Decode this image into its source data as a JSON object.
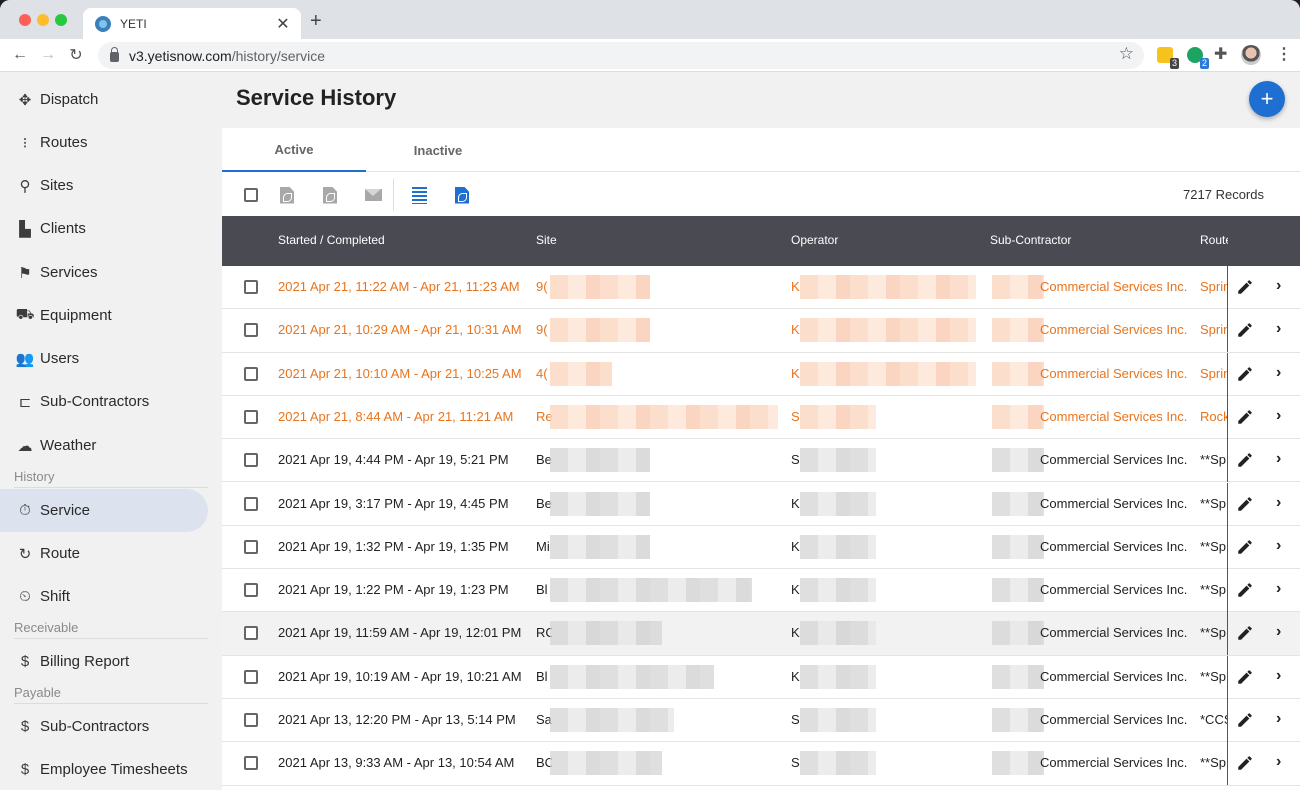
{
  "browser": {
    "tab_title": "YETI",
    "url_host": "v3.yetisnow.com",
    "url_path": "/history/service",
    "extensions": [
      {
        "name": "yellow-extension",
        "badge": "3"
      },
      {
        "name": "green-extension",
        "badge": "2"
      }
    ]
  },
  "sidebar": {
    "items": [
      {
        "label": "Dispatch",
        "icon": "dispatch-icon",
        "glyph": "✥"
      },
      {
        "label": "Routes",
        "icon": "routes-icon",
        "glyph": "⁝"
      },
      {
        "label": "Sites",
        "icon": "sites-icon",
        "glyph": "⚲"
      },
      {
        "label": "Clients",
        "icon": "clients-icon",
        "glyph": "▙"
      },
      {
        "label": "Services",
        "icon": "services-icon",
        "glyph": "⚑"
      },
      {
        "label": "Equipment",
        "icon": "equipment-icon",
        "glyph": "⛟"
      },
      {
        "label": "Users",
        "icon": "users-icon",
        "glyph": "👥"
      },
      {
        "label": "Sub-Contractors",
        "icon": "subcontractors-icon",
        "glyph": "⊏"
      },
      {
        "label": "Weather",
        "icon": "cloud-icon",
        "glyph": "☁"
      }
    ],
    "sections": [
      {
        "title": "History",
        "items": [
          {
            "label": "Service",
            "icon": "service-history-icon",
            "glyph": "⏱",
            "active": true
          },
          {
            "label": "Route",
            "icon": "route-history-icon",
            "glyph": "↻"
          },
          {
            "label": "Shift",
            "icon": "shift-history-icon",
            "glyph": "⏲"
          }
        ]
      },
      {
        "title": "Receivable",
        "items": [
          {
            "label": "Billing Report",
            "icon": "billing-icon",
            "glyph": "$"
          }
        ]
      },
      {
        "title": "Payable",
        "items": [
          {
            "label": "Sub-Contractors",
            "icon": "payable-subcontractors-icon",
            "glyph": "$"
          },
          {
            "label": "Employee Timesheets",
            "icon": "timesheets-icon",
            "glyph": "$"
          }
        ]
      }
    ]
  },
  "main": {
    "title": "Service History",
    "fab_label": "+",
    "tabs": [
      {
        "label": "Active",
        "active": true
      },
      {
        "label": "Inactive",
        "active": false
      }
    ],
    "records_label": "7217 Records",
    "columns": [
      "Started / Completed",
      "Site",
      "Operator",
      "Sub-Contractor",
      "Route"
    ],
    "accent_color": "#1e6fd1",
    "highlight_color": "#e8741d",
    "rows": [
      {
        "date": "2021 Apr 21, 11:22 AM - Apr 21, 11:23 AM",
        "site": "9(",
        "operator": "K",
        "sub": "Commercial Services Inc.",
        "route": "Sprin",
        "highlight": true
      },
      {
        "date": "2021 Apr 21, 10:29 AM - Apr 21, 10:31 AM",
        "site": "9(",
        "operator": "K",
        "sub": "Commercial Services Inc.",
        "route": "Sprin",
        "highlight": true
      },
      {
        "date": "2021 Apr 21, 10:10 AM - Apr 21, 10:25 AM",
        "site": "4(",
        "operator": "K",
        "sub": "Commercial Services Inc.",
        "route": "Sprin",
        "highlight": true
      },
      {
        "date": "2021 Apr 21, 8:44 AM - Apr 21, 11:21 AM",
        "site": "Re",
        "operator": "S",
        "sub": "Commercial Services Inc.",
        "route": "Rock",
        "highlight": true
      },
      {
        "date": "2021 Apr 19, 4:44 PM - Apr 19, 5:21 PM",
        "site": "Be",
        "operator": "S",
        "sub": "Commercial Services Inc.",
        "route": "**Sp",
        "highlight": false
      },
      {
        "date": "2021 Apr 19, 3:17 PM - Apr 19, 4:45 PM",
        "site": "Be",
        "operator": "K",
        "sub": "Commercial Services Inc.",
        "route": "**Sp",
        "highlight": false
      },
      {
        "date": "2021 Apr 19, 1:32 PM - Apr 19, 1:35 PM",
        "site": "Mi",
        "operator": "K",
        "sub": "Commercial Services Inc.",
        "route": "**Sp",
        "highlight": false
      },
      {
        "date": "2021 Apr 19, 1:22 PM - Apr 19, 1:23 PM",
        "site": "Bl",
        "operator": "K",
        "sub": "Commercial Services Inc.",
        "route": "**Sp",
        "highlight": false
      },
      {
        "date": "2021 Apr 19, 11:59 AM - Apr 19, 12:01 PM",
        "site": "RC",
        "operator": "K",
        "sub": "Commercial Services Inc.",
        "route": "**Sp",
        "highlight": false
      },
      {
        "date": "2021 Apr 19, 10:19 AM - Apr 19, 10:21 AM",
        "site": "Bl",
        "operator": "K",
        "sub": "Commercial Services Inc.",
        "route": "**Sp",
        "highlight": false
      },
      {
        "date": "2021 Apr 13, 12:20 PM - Apr 13, 5:14 PM",
        "site": "Sa",
        "operator": "S",
        "sub": "Commercial Services Inc.",
        "route": "*CCS",
        "highlight": false
      },
      {
        "date": "2021 Apr 13, 9:33 AM - Apr 13, 10:54 AM",
        "site": "BC",
        "operator": "S",
        "sub": "Commercial Services Inc.",
        "route": "**Sp",
        "highlight": false
      }
    ]
  }
}
